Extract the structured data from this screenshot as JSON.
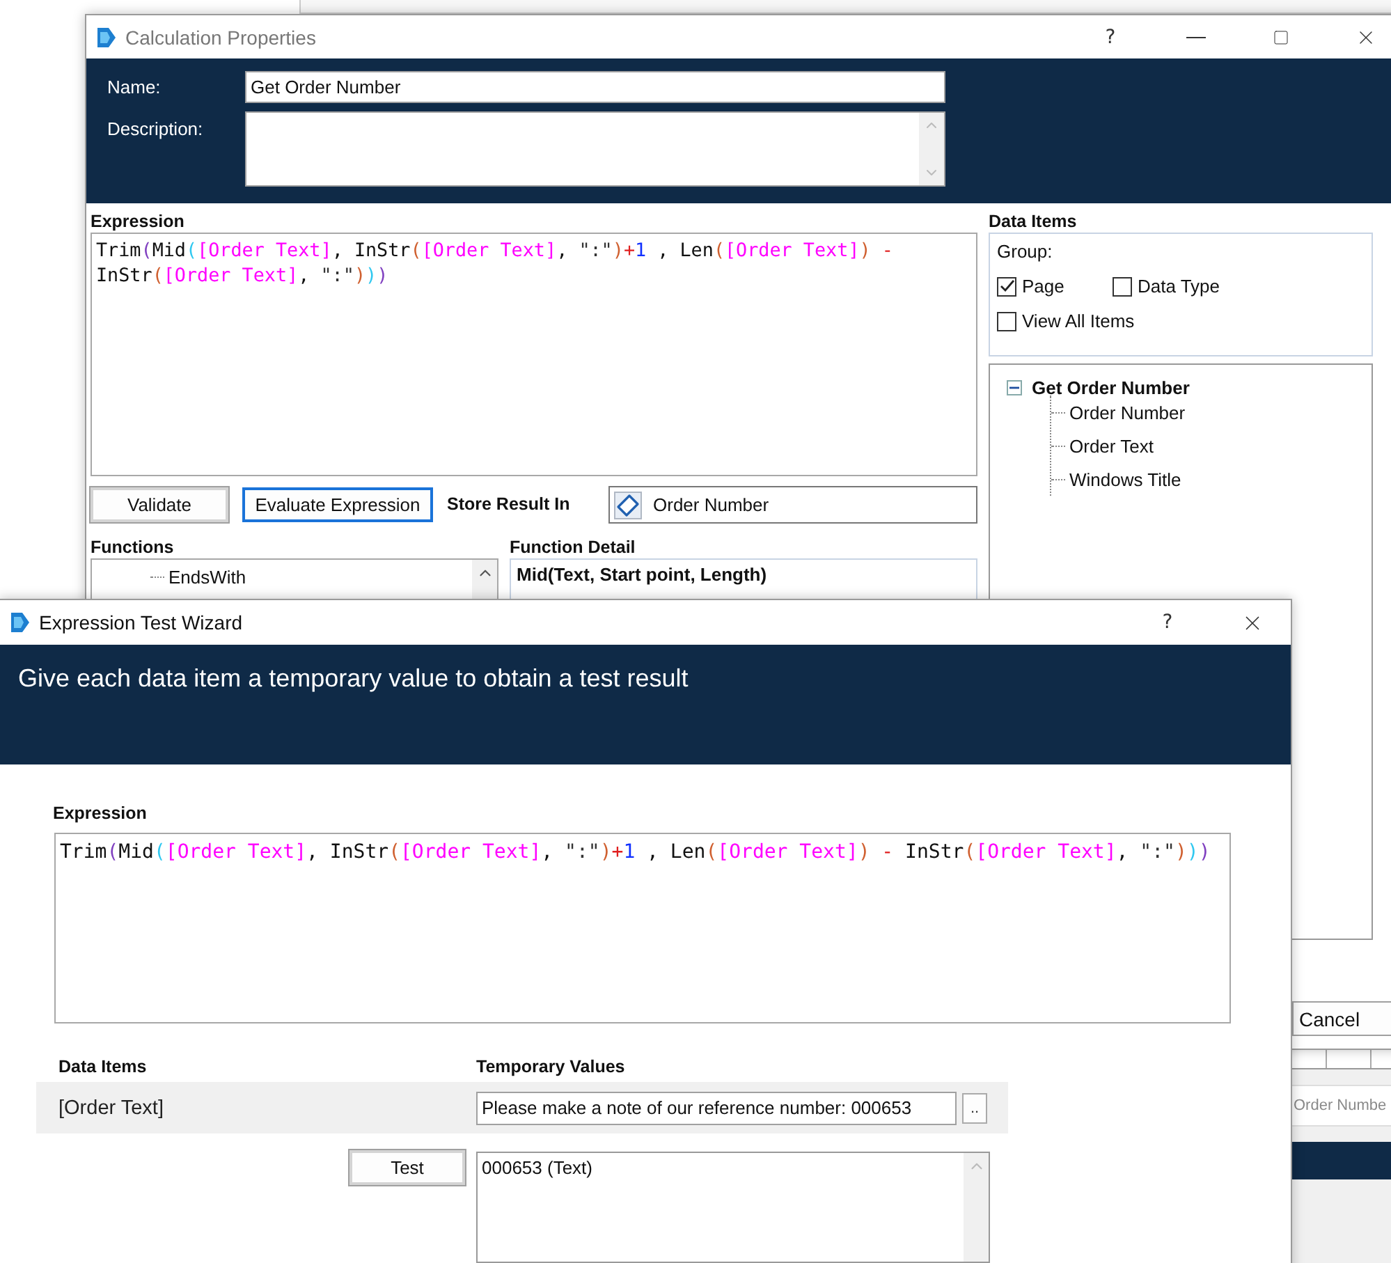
{
  "background_app": {
    "field_value": "Order Numbe"
  },
  "calculation_properties": {
    "title": "Calculation Properties",
    "help_button": "?",
    "name_label": "Name:",
    "name_value": "Get Order Number",
    "description_label": "Description:",
    "expression": {
      "label": "Expression",
      "lines": [
        [
          {
            "text": "Trim",
            "kind": "function"
          },
          {
            "text": "(",
            "kind": "paren",
            "color": "#8040c0"
          },
          {
            "text": "Mid",
            "kind": "function"
          },
          {
            "text": "(",
            "kind": "paren",
            "color": "#30c8f0"
          },
          {
            "text": "[Order Text]",
            "kind": "item"
          },
          {
            "text": ", ",
            "kind": "plain"
          },
          {
            "text": "InStr",
            "kind": "function"
          },
          {
            "text": "(",
            "kind": "paren",
            "color": "#d06030"
          },
          {
            "text": "[Order Text]",
            "kind": "item"
          },
          {
            "text": ", ",
            "kind": "plain"
          },
          {
            "text": "\":\"",
            "kind": "string"
          },
          {
            "text": ")",
            "kind": "paren",
            "color": "#d06030"
          },
          {
            "text": "+",
            "kind": "operator"
          },
          {
            "text": "1",
            "kind": "number"
          },
          {
            "text": " , ",
            "kind": "plain"
          },
          {
            "text": "Len",
            "kind": "function"
          },
          {
            "text": "(",
            "kind": "paren",
            "color": "#d06030"
          },
          {
            "text": "[Order Text]",
            "kind": "item"
          },
          {
            "text": ")",
            "kind": "paren",
            "color": "#d06030"
          },
          {
            "text": " -",
            "kind": "operator"
          }
        ],
        [
          {
            "text": "InStr",
            "kind": "function"
          },
          {
            "text": "(",
            "kind": "paren",
            "color": "#d06030"
          },
          {
            "text": "[Order Text]",
            "kind": "item"
          },
          {
            "text": ", ",
            "kind": "plain"
          },
          {
            "text": "\":\"",
            "kind": "string"
          },
          {
            "text": ")",
            "kind": "paren",
            "color": "#d06030"
          },
          {
            "text": ")",
            "kind": "paren",
            "color": "#30c8f0"
          },
          {
            "text": ")",
            "kind": "paren",
            "color": "#8040c0"
          }
        ]
      ]
    },
    "buttons": [
      {
        "label": "Validate",
        "focused": false
      },
      {
        "label": "Evaluate Expression",
        "focused": true
      }
    ],
    "store_result": {
      "label": "Store Result In",
      "value": "Order Number"
    },
    "functions": {
      "label": "Functions",
      "items": [
        "EndsWith"
      ]
    },
    "function_detail": {
      "label": "Function Detail",
      "signature": "Mid(Text, Start point, Length)"
    },
    "data_items": {
      "label": "Data Items",
      "group_label": "Group:",
      "checkbox_rows": [
        [
          {
            "label": "Page",
            "checked": true
          },
          {
            "label": "Data Type",
            "checked": false
          }
        ],
        [
          {
            "label": "View All Items",
            "checked": false
          }
        ]
      ],
      "tree": [
        {
          "label": "Get Order Number",
          "expanded": true,
          "children": [
            {
              "label": "Order Number"
            },
            {
              "label": "Order Text"
            },
            {
              "label": "Windows Title"
            }
          ]
        }
      ]
    },
    "cancel_button": "Cancel"
  },
  "expression_test_wizard": {
    "title": "Expression Test Wizard",
    "help_button": "?",
    "heading": "Give each data item a temporary value to obtain a test result",
    "expression": {
      "label": "Expression",
      "lines": [
        [
          {
            "text": "Trim",
            "kind": "function"
          },
          {
            "text": "(",
            "kind": "paren",
            "color": "#8040c0"
          },
          {
            "text": "Mid",
            "kind": "function"
          },
          {
            "text": "(",
            "kind": "paren",
            "color": "#30c8f0"
          },
          {
            "text": "[Order Text]",
            "kind": "item"
          },
          {
            "text": ", ",
            "kind": "plain"
          },
          {
            "text": "InStr",
            "kind": "function"
          },
          {
            "text": "(",
            "kind": "paren",
            "color": "#d06030"
          },
          {
            "text": "[Order Text]",
            "kind": "item"
          },
          {
            "text": ", ",
            "kind": "plain"
          },
          {
            "text": "\":\"",
            "kind": "string"
          },
          {
            "text": ")",
            "kind": "paren",
            "color": "#d06030"
          },
          {
            "text": "+",
            "kind": "operator"
          },
          {
            "text": "1",
            "kind": "number"
          },
          {
            "text": " , ",
            "kind": "plain"
          },
          {
            "text": "Len",
            "kind": "function"
          },
          {
            "text": "(",
            "kind": "paren",
            "color": "#d06030"
          },
          {
            "text": "[Order Text]",
            "kind": "item"
          },
          {
            "text": ")",
            "kind": "paren",
            "color": "#d06030"
          },
          {
            "text": " - ",
            "kind": "operator"
          },
          {
            "text": "InStr",
            "kind": "function"
          },
          {
            "text": "(",
            "kind": "paren",
            "color": "#d06030"
          },
          {
            "text": "[Order Text]",
            "kind": "item"
          },
          {
            "text": ", ",
            "kind": "plain"
          },
          {
            "text": "\":\"",
            "kind": "string"
          },
          {
            "text": ")",
            "kind": "paren",
            "color": "#d06030"
          },
          {
            "text": ")",
            "kind": "paren",
            "color": "#30c8f0"
          },
          {
            "text": ")",
            "kind": "paren",
            "color": "#8040c0"
          }
        ]
      ]
    },
    "data_items_header": "Data Items",
    "temporary_values_header": "Temporary Values",
    "rows": [
      {
        "item": "[Order Text]",
        "value": "Please make a note of our reference number: 000653",
        "browse_button": ".."
      }
    ],
    "test_button": "Test",
    "result": "000653 (Text)"
  }
}
